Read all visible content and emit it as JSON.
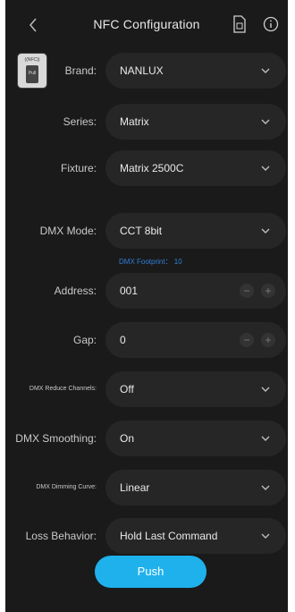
{
  "header": {
    "title": "NFC Configuration"
  },
  "nfc_badge": {
    "label": "((NFC))",
    "phone_text": "Pull"
  },
  "fields": {
    "brand": {
      "label": "Brand:",
      "value": "NANLUX"
    },
    "series": {
      "label": "Series:",
      "value": "Matrix"
    },
    "fixture": {
      "label": "Fixture:",
      "value": "Matrix 2500C"
    },
    "dmx_mode": {
      "label": "DMX Mode:",
      "value": "CCT 8bit"
    },
    "address": {
      "label": "Address:",
      "value": "001"
    },
    "gap": {
      "label": "Gap:",
      "value": "0"
    },
    "reduce_channels": {
      "label": "DMX Reduce Channels:",
      "value": "Off"
    },
    "smoothing": {
      "label": "DMX Smoothing:",
      "value": "On"
    },
    "dimming_curve": {
      "label": "DMX Dimming Curve:",
      "value": "Linear"
    },
    "loss_behavior": {
      "label": "Loss Behavior:",
      "value": "Hold Last Command"
    }
  },
  "dmx_footprint": "DMX Footprint： 10",
  "stepper": {
    "minus": "−",
    "plus": "+"
  },
  "push_button": "Push",
  "colors": {
    "background": "#1a1a1a",
    "field": "#262626",
    "accent": "#1fb1ec",
    "link": "#2f7fd6"
  }
}
